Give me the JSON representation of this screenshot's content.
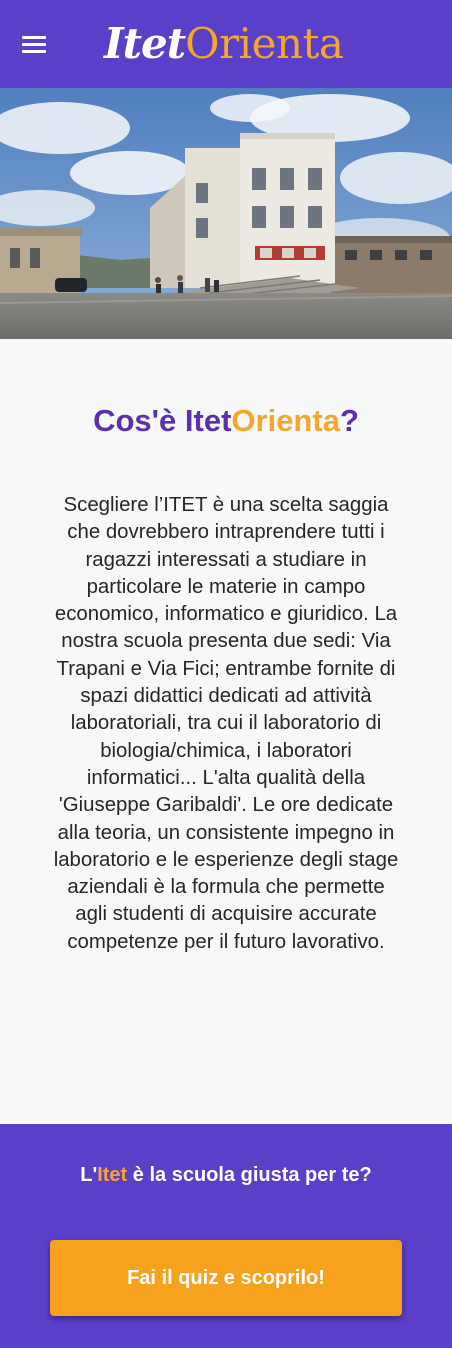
{
  "header": {
    "menu_icon": "hamburger-menu-icon",
    "logo": {
      "part1": "Itet",
      "part2": "Orienta"
    }
  },
  "hero": {
    "image": "school-building-photo"
  },
  "main": {
    "heading": {
      "before": "Cos'è Itet",
      "highlight": "Orienta",
      "after": "?"
    },
    "description": "Scegliere l’ITET è una scelta saggia che dovrebbero intraprendere tutti i ragazzi interessati a studiare in particolare le materie in campo economico, informatico e giuridico. La nostra scuola presenta due sedi: Via Trapani e Via Fici; entrambe fornite di spazi didattici dedicati ad attività laboratoriali, tra cui il laboratorio di biologia/chimica, i laboratori informatici... L'alta qualità della 'Giuseppe Garibaldi'. Le ore dedicate alla teoria, un consistente impegno in laboratorio e le esperienze degli stage aziendali è la formula che permette agli studenti di acquisire accurate competenze per il futuro lavorativo."
  },
  "footer": {
    "question": {
      "before": "L'",
      "highlight": "Itet",
      "after": " è la scuola giusta per te?"
    },
    "quiz_button": "Fai il quiz e scoprilo!"
  },
  "colors": {
    "primary": "#5a3fc8",
    "heading": "#5a2fb0",
    "accent": "#f3a72b",
    "button": "#f6a21e",
    "background": "#f8f8f8"
  }
}
